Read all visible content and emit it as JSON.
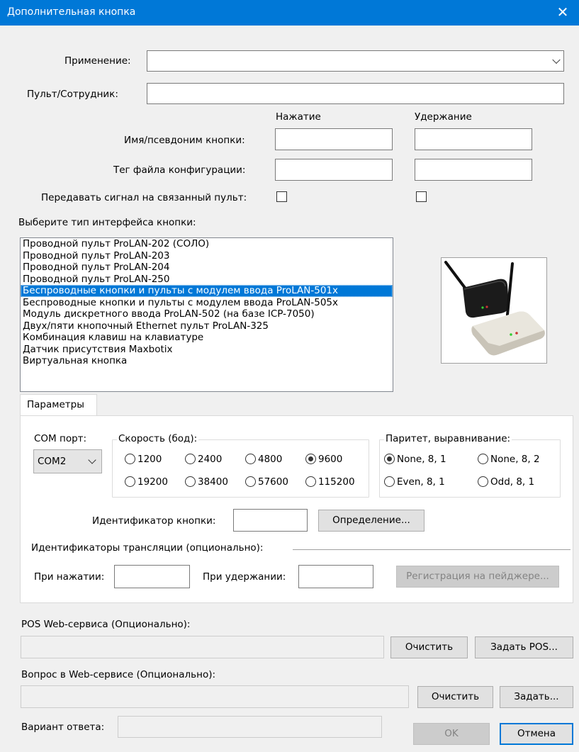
{
  "window": {
    "title": "Дополнительная кнопка",
    "close_glyph": "✕"
  },
  "form": {
    "application_label": "Применение:",
    "application_value": "",
    "console_label": "Пульт/Сотрудник:",
    "console_value": "",
    "press_header": "Нажатие",
    "hold_header": "Удержание",
    "alias_label": "Имя/псевдоним кнопки:",
    "config_tag_label": "Тег файла конфигурации:",
    "send_signal_label": "Передавать сигнал на связанный пульт:",
    "interface_type_label": "Выберите тип интерфейса кнопки:"
  },
  "interface_list": {
    "items": [
      "Проводной пульт ProLAN-202 (СОЛО)",
      "Проводной пульт ProLAN-203",
      "Проводной пульт ProLAN-204",
      "Проводной пульт ProLAN-250",
      "Беспроводные кнопки и пульты с модулем ввода ProLAN-501x",
      "Беспроводные кнопки и пульты с модулем ввода ProLAN-505x",
      "Модуль дискретного ввода ProLAN-502 (на базе ICP-7050)",
      "Двух/пяти кнопочный Ethernet пульт ProLAN-325",
      "Комбинация клавиш на клавиатуре",
      "Датчик присутствия Maxbotix",
      "Виртуальная кнопка"
    ],
    "selected_index": 4
  },
  "params": {
    "tab_label": "Параметры",
    "com_label": "COM порт:",
    "com_value": "COM2",
    "speed_label": "Скорость (бод):",
    "speeds": [
      "1200",
      "2400",
      "4800",
      "9600",
      "19200",
      "38400",
      "57600",
      "115200"
    ],
    "speed_selected": "9600",
    "parity_label": "Паритет, выравнивание:",
    "parities": [
      "None, 8, 1",
      "None, 8, 2",
      "Even, 8, 1",
      "Odd, 8, 1"
    ],
    "parity_selected": "None, 8, 1",
    "button_id_label": "Идентификатор кнопки:",
    "button_id_value": "",
    "define_button": "Определение...",
    "translation_label": "Идентификаторы трансляции (опционально):",
    "on_press_label": "При нажатии:",
    "on_hold_label": "При удержании:",
    "pager_button": "Регистрация на пейджере..."
  },
  "web": {
    "pos_label": "POS Web-сервиса (Опционально):",
    "pos_clear": "Очистить",
    "pos_set": "Задать POS...",
    "question_label": "Вопрос в Web-сервисе (Опционально):",
    "question_clear": "Очистить",
    "question_set": "Задать...",
    "answer_label": "Вариант ответа:"
  },
  "footer": {
    "ok": "OK",
    "cancel": "Отмена"
  },
  "colors": {
    "titlebar": "#0078d7",
    "selection": "#0078d7",
    "window_bg": "#f0f0f0"
  }
}
